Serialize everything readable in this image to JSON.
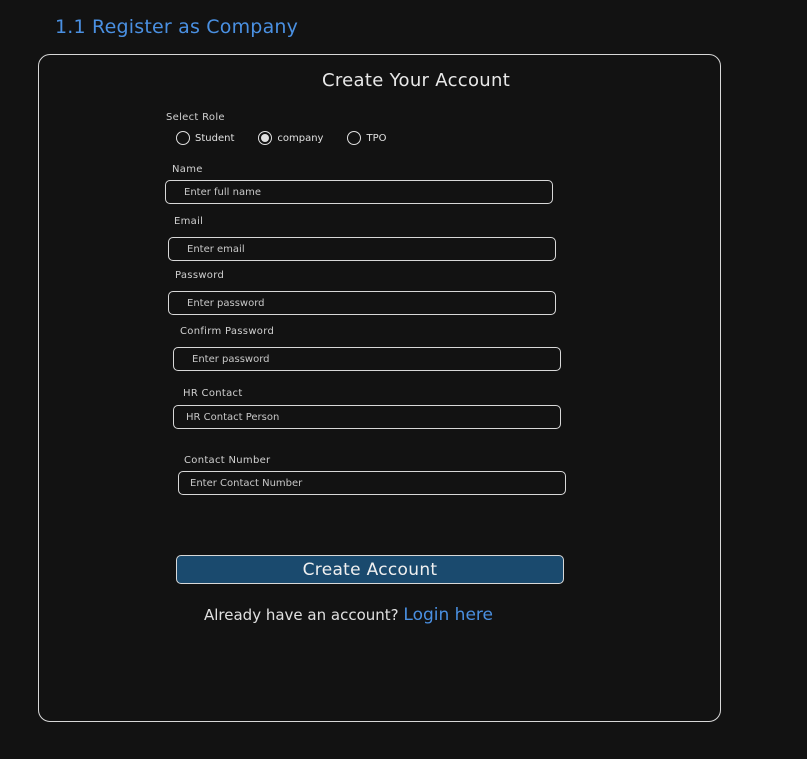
{
  "section_title": "1.1 Register as Company",
  "form": {
    "title": "Create Your Account",
    "role": {
      "label": "Select Role",
      "options": [
        "Student",
        "company",
        "TPO"
      ],
      "selected": "company"
    },
    "fields": {
      "name": {
        "label": "Name",
        "placeholder": "Enter full name",
        "value": ""
      },
      "email": {
        "label": "Email",
        "placeholder": "Enter email",
        "value": ""
      },
      "password": {
        "label": "Password",
        "placeholder": "Enter password",
        "value": ""
      },
      "confirm_password": {
        "label": "Confirm Password",
        "placeholder": "Enter password",
        "value": ""
      },
      "hr_contact": {
        "label": "HR Contact",
        "placeholder": "HR Contact Person",
        "value": ""
      },
      "contact_number": {
        "label": "Contact Number",
        "placeholder": "Enter Contact Number",
        "value": ""
      }
    },
    "submit_label": "Create Account",
    "login_prompt": "Already have an account?",
    "login_link": "Login here"
  },
  "colors": {
    "background": "#121212",
    "accent": "#4a90e2",
    "button_fill": "#1a4a6e",
    "border": "#d8d8d8"
  }
}
